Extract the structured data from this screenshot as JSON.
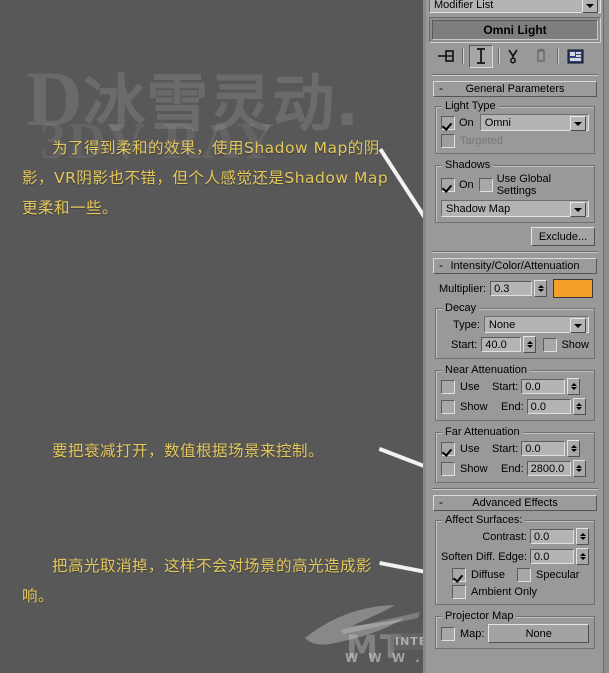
{
  "tutorial": {
    "watermark_main": "冰雪灵动.",
    "watermark_d": "D",
    "watermark_sub": "3DV-RAY",
    "watermark_sub_red": "V-",
    "notes": [
      "为了得到柔和的效果，使用Shadow Map的阴影，VR阴影也不错，但个人感觉还是Shadow Map更柔和一些。",
      "要把衰减打开，数值根据场景来控制。",
      "把高光取消掉，这样不会对场景的高光造成影响。"
    ],
    "mt_logo": "MT",
    "mt_tagline": "INTERIOR DESIGN",
    "mt_url": "W W W . M T - B"
  },
  "panel": {
    "modifier_list": "Modifier List",
    "stack_entry": "Omni Light",
    "toolbar_icons": [
      "pin-stack-icon",
      "show-end-result-icon",
      "make-unique-icon",
      "remove-modifier-icon",
      "configure-modifier-sets-icon"
    ],
    "general_parameters": {
      "title": "General Parameters",
      "collapse": "-",
      "light_type": {
        "group_label": "Light Type",
        "on_label": "On",
        "on_checked": true,
        "type_value": "Omni",
        "targeted_label": "Targeted",
        "targeted_checked": false
      },
      "shadows": {
        "group_label": "Shadows",
        "on_label": "On",
        "on_checked": true,
        "use_global_label": "Use Global Settings",
        "use_global_checked": false,
        "shadow_type": "Shadow Map",
        "exclude_label": "Exclude..."
      }
    },
    "intensity": {
      "title": "Intensity/Color/Attenuation",
      "collapse": "-",
      "multiplier_label": "Multiplier:",
      "multiplier_value": "0.3",
      "color_swatch": "#F2A02A",
      "decay": {
        "group_label": "Decay",
        "type_label": "Type:",
        "type_value": "None",
        "start_label": "Start:",
        "start_value": "40.0",
        "show_label": "Show",
        "show_checked": false
      },
      "near_attenuation": {
        "group_label": "Near Attenuation",
        "use_label": "Use",
        "use_checked": false,
        "show_label": "Show",
        "show_checked": false,
        "start_label": "Start:",
        "start_value": "0.0",
        "end_label": "End:",
        "end_value": "0.0"
      },
      "far_attenuation": {
        "group_label": "Far Attenuation",
        "use_label": "Use",
        "use_checked": true,
        "show_label": "Show",
        "show_checked": false,
        "start_label": "Start:",
        "start_value": "0.0",
        "end_label": "End:",
        "end_value": "2800.0"
      }
    },
    "advanced_effects": {
      "title": "Advanced Effects",
      "collapse": "-",
      "affect_surfaces_label": "Affect Surfaces:",
      "contrast_label": "Contrast:",
      "contrast_value": "0.0",
      "soften_label": "Soften Diff. Edge:",
      "soften_value": "0.0",
      "diffuse_label": "Diffuse",
      "diffuse_checked": true,
      "specular_label": "Specular",
      "specular_checked": false,
      "ambient_only_label": "Ambient Only",
      "ambient_only_checked": false,
      "projector_map_label": "Projector Map",
      "map_label": "Map:",
      "map_value": "None",
      "map_checked": false
    }
  }
}
